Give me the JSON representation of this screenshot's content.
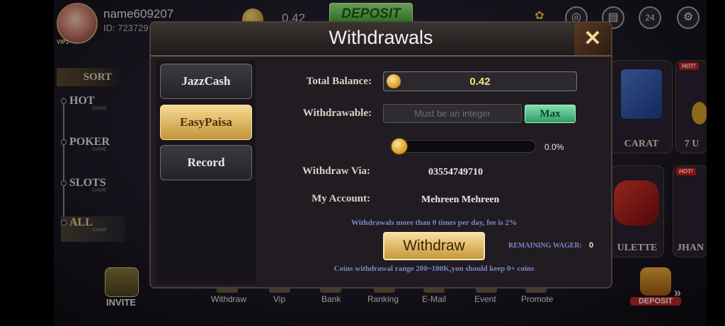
{
  "user": {
    "name": "name609207",
    "id": "ID: 723729",
    "vip": "VIP1"
  },
  "top_bar": {
    "balance": "0.42",
    "deposit_label": "DEPOSIT",
    "icons": [
      "gift-icon",
      "wheel-icon",
      "clipboard-icon",
      "support-24-icon",
      "settings-icon"
    ],
    "icon_glyphs": [
      "✿",
      "◎",
      "▤",
      "24",
      "⚙"
    ]
  },
  "sidebar": {
    "sort_label": "SORT",
    "categories": [
      {
        "name": "HOT",
        "sub": "GAME"
      },
      {
        "name": "POKER",
        "sub": "GAME"
      },
      {
        "name": "SLOTS",
        "sub": "GAME"
      },
      {
        "name": "ALL",
        "sub": "GAME"
      }
    ]
  },
  "games": {
    "tiles": [
      "CARAT",
      "7 U",
      "ULETTE",
      "JHAN"
    ],
    "hot_badge": "HOT!"
  },
  "bottom_nav": {
    "invite": "INVITE",
    "items": [
      "Withdraw",
      "Vip",
      "Bank",
      "Ranking",
      "E-Mail",
      "Event",
      "Promote"
    ],
    "deposit": "DEPOSIT"
  },
  "modal": {
    "title": "Withdrawals",
    "close_glyph": "✕",
    "menu": [
      "JazzCash",
      "EasyPaisa",
      "Record"
    ],
    "active_menu": "EasyPaisa",
    "total_balance_label": "Total Balance:",
    "total_balance_value": "0.42",
    "withdrawable_label": "Withdrawable:",
    "withdrawable_placeholder": "Must be an integer",
    "max_label": "Max",
    "slider_percent": 0,
    "slider_text": "0.0%",
    "withdraw_via_label": "Withdraw Via:",
    "withdraw_via_value": "03554749710",
    "my_account_label": "My Account:",
    "my_account_value": "Mehreen Mehreen",
    "fee_notice": "Withdrawals more than 0 times per day,  fee is 2%",
    "withdraw_button": "Withdraw",
    "remaining_wager_label": "REMAINING WAGER:",
    "remaining_wager_value": "0",
    "range_notice": "Coins withdrawal range 200~100K,you should keep 0+ coins"
  }
}
